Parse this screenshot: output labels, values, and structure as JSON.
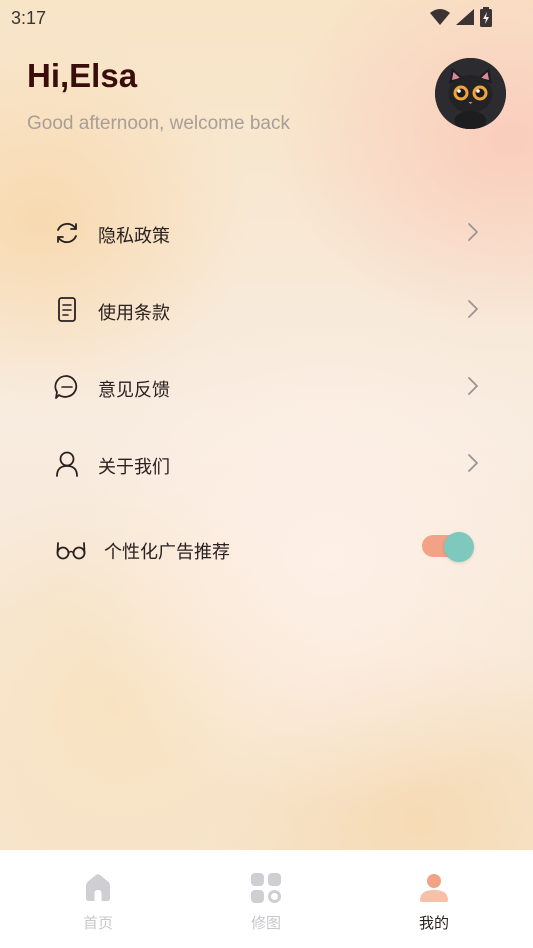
{
  "status_bar": {
    "time": "3:17",
    "icons": [
      "wifi-icon",
      "signal-icon",
      "battery-icon"
    ]
  },
  "header": {
    "greeting": "Hi,Elsa",
    "subtitle": "Good afternoon, welcome back",
    "avatar": "cat-avatar"
  },
  "menu": {
    "items": [
      {
        "label": "隐私政策",
        "icon": "refresh-icon"
      },
      {
        "label": "使用条款",
        "icon": "document-icon"
      },
      {
        "label": "意见反馈",
        "icon": "chat-icon"
      },
      {
        "label": "关于我们",
        "icon": "person-icon"
      }
    ],
    "toggle_item": {
      "label": "个性化广告推荐",
      "icon": "glasses-icon",
      "enabled": true
    }
  },
  "bottom_nav": {
    "items": [
      {
        "label": "首页",
        "icon": "home-icon",
        "active": false
      },
      {
        "label": "修图",
        "icon": "grid-icon",
        "active": false
      },
      {
        "label": "我的",
        "icon": "profile-icon",
        "active": true
      }
    ]
  },
  "colors": {
    "accent": "#f3a285",
    "toggle_knob": "#7ec8be",
    "greeting": "#3a0d0d",
    "inactive_nav": "#c8c8cc"
  }
}
